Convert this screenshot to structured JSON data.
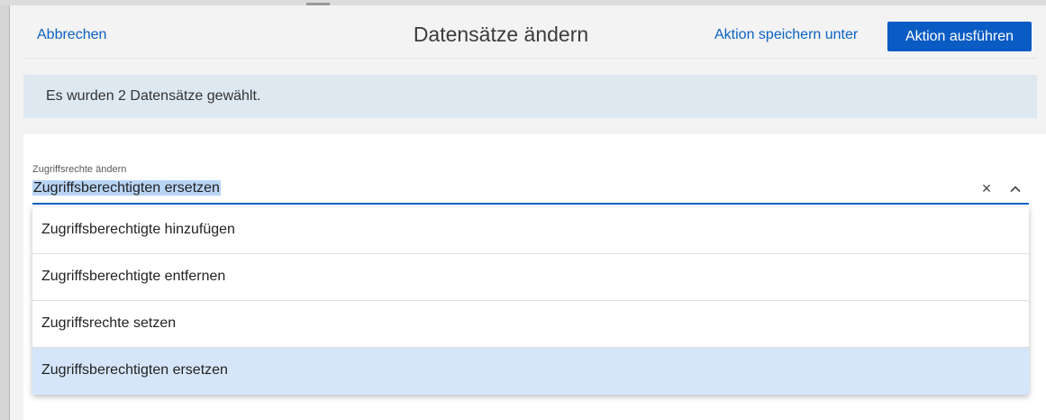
{
  "header": {
    "cancel_label": "Abbrechen",
    "title": "Datensätze ändern",
    "save_as_label": "Aktion speichern unter",
    "run_label": "Aktion ausführen"
  },
  "info": {
    "message": "Es wurden 2 Datensätze gewählt."
  },
  "field": {
    "label": "Zugriffsrechte ändern",
    "value": "Zugriffsberechtigten ersetzen",
    "clear_icon": "×"
  },
  "dropdown": {
    "options": [
      {
        "label": "Zugriffsberechtigte hinzufügen",
        "selected": false
      },
      {
        "label": "Zugriffsberechtigte entfernen",
        "selected": false
      },
      {
        "label": "Zugriffsrechte setzen",
        "selected": false
      },
      {
        "label": "Zugriffsberechtigten ersetzen",
        "selected": true
      }
    ]
  },
  "colors": {
    "accent": "#0a5bc4",
    "link": "#0b62c4",
    "banner_bg": "#dde8f1",
    "selected_bg": "#d5e6fa",
    "selection_highlight": "#b9d5f6"
  }
}
